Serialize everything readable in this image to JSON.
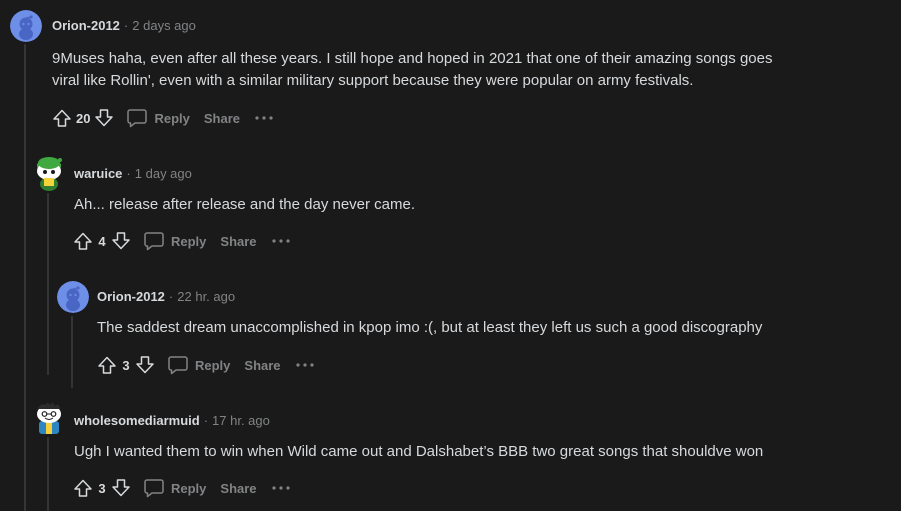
{
  "colors": {
    "background": "#1a1a1b",
    "text": "#d7dadc",
    "muted": "#818384",
    "thread_line": "#343536",
    "avatar_blue": "#6e8fe8"
  },
  "icons": {
    "upvote": "arrow-up-outline-icon",
    "downvote": "arrow-down-outline-icon",
    "reply": "speech-bubble-icon",
    "more": "ellipsis-icon"
  },
  "action_labels": {
    "reply": "Reply",
    "share": "Share",
    "more": "···"
  },
  "separator": "·",
  "comments": [
    {
      "username": "Orion-2012",
      "time": "2 days ago",
      "text_lines": [
        "9Muses haha, even after all these years. I still hope and hoped in 2021 that one of their amazing songs goes",
        "viral like Rollin', even with a similar military support because they were popular on army festivals."
      ],
      "score": "20"
    },
    {
      "username": "waruice",
      "time": "1 day ago",
      "text_lines": [
        "Ah... release after release and the day never came."
      ],
      "score": "4"
    },
    {
      "username": "Orion-2012",
      "time": "22 hr. ago",
      "text_lines": [
        "The saddest dream unaccomplished in kpop imo :(, but at least they left us such a good discography"
      ],
      "score": "3"
    },
    {
      "username": "wholesomediarmuid",
      "time": "17 hr. ago",
      "text_lines": [
        "Ugh I wanted them to win when Wild came out and Dalshabet’s BBB two great songs that shouldve won"
      ],
      "score": "3"
    }
  ]
}
